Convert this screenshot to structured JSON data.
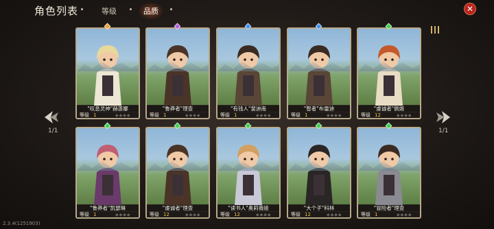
{
  "header": {
    "title": "角色列表",
    "tabs": [
      {
        "label": "等级"
      },
      {
        "label": "品质"
      }
    ]
  },
  "pagination": {
    "left": "1/1",
    "right": "1/1"
  },
  "version": "2.3.4(1251903)",
  "level_label": "等级",
  "colors": {
    "orange": "#e8a23a",
    "purple": "#b45ae0",
    "blue": "#3f8ff0",
    "green": "#3fcf4a",
    "level_value": "#f0c34a"
  },
  "characters": [
    {
      "name": "\"叹息灵神\"赫莲娜",
      "level": "1",
      "quality": "orange",
      "hair": "#e8d89a",
      "cloak": "#ece6d4"
    },
    {
      "name": "\"鲁莽者\"理查",
      "level": "1",
      "quality": "purple",
      "hair": "#4a3428",
      "cloak": "#4a3428"
    },
    {
      "name": "\"有钱人\"斐迪南",
      "level": "1",
      "quality": "blue",
      "hair": "#3a2b22",
      "cloak": "#5a4636"
    },
    {
      "name": "\"智者\"布雷迪",
      "level": "1",
      "quality": "blue",
      "hair": "#3a2b22",
      "cloak": "#5a4636"
    },
    {
      "name": "\"虔诚者\"佩姬",
      "level": "12",
      "quality": "green",
      "hair": "#c45a2c",
      "cloak": "#e8dcc4"
    },
    {
      "name": "\"鲁莽者\"凯瑟琳",
      "level": "1",
      "quality": "green",
      "hair": "#c05f74",
      "cloak": "#6a3a6a"
    },
    {
      "name": "\"虔诚者\"理查",
      "level": "12",
      "quality": "green",
      "hair": "#4a3428",
      "cloak": "#4a3428"
    },
    {
      "name": "\"读书人\"奥莉薇娅",
      "level": "12",
      "quality": "green",
      "hair": "#d2a060",
      "cloak": "#c8c8d6"
    },
    {
      "name": "\"大个子\"科林",
      "level": "12",
      "quality": "green",
      "hair": "#2a2626",
      "cloak": "#2a2626"
    },
    {
      "name": "\"冒险者\"理查",
      "level": "1",
      "quality": "green",
      "hair": "#3a2b22",
      "cloak": "#8a8a92"
    }
  ]
}
